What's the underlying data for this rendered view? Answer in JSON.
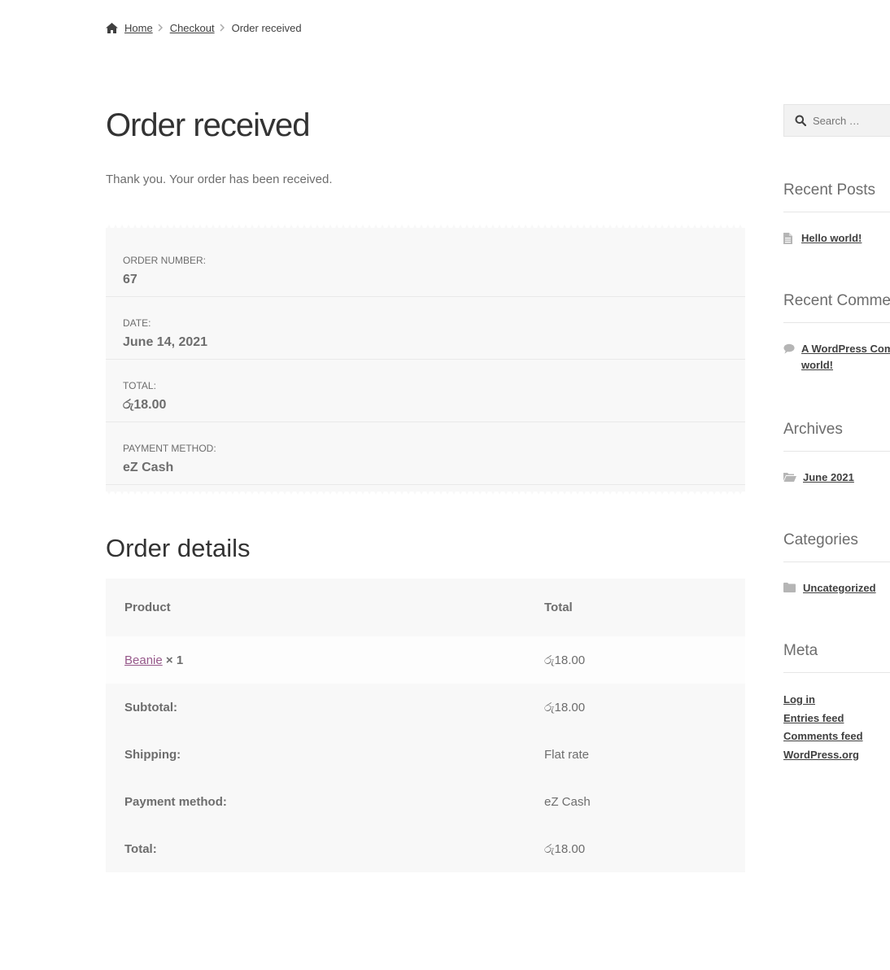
{
  "breadcrumb": {
    "home": "Home",
    "checkout": "Checkout",
    "current": "Order received"
  },
  "page": {
    "title": "Order received",
    "thanks": "Thank you. Your order has been received."
  },
  "overview": [
    {
      "label": "Order number:",
      "value": "67"
    },
    {
      "label": "Date:",
      "value": "June 14, 2021"
    },
    {
      "label": "Total:",
      "value": "රු18.00"
    },
    {
      "label": "Payment method:",
      "value": "eZ Cash"
    }
  ],
  "details": {
    "title": "Order details",
    "headers": {
      "product": "Product",
      "total": "Total"
    },
    "item": {
      "name": "Beanie",
      "qty": "× 1",
      "total": "රු18.00"
    },
    "rows": [
      {
        "label": "Subtotal:",
        "value": "රු18.00"
      },
      {
        "label": "Shipping:",
        "value": "Flat rate"
      },
      {
        "label": "Payment method:",
        "value": "eZ Cash"
      },
      {
        "label": "Total:",
        "value": "රු18.00"
      }
    ]
  },
  "sidebar": {
    "search_placeholder": "Search …",
    "recent_posts": {
      "title": "Recent Posts",
      "items": [
        "Hello world!"
      ]
    },
    "recent_comments": {
      "title": "Recent Comments",
      "line1": "A WordPress Commenter on Hello",
      "line2": "world!"
    },
    "archives": {
      "title": "Archives",
      "items": [
        "June 2021"
      ]
    },
    "categories": {
      "title": "Categories",
      "items": [
        "Uncategorized"
      ]
    },
    "meta": {
      "title": "Meta",
      "items": [
        "Log in",
        "Entries feed",
        "Comments feed",
        "WordPress.org"
      ]
    }
  },
  "colors": {
    "accent": "#96588a",
    "text": "#6d6d6d",
    "heading": "#333333",
    "panel": "#f8f8f8"
  },
  "icons": [
    "home-icon",
    "chevron-right-icon",
    "search-icon",
    "document-icon",
    "comment-icon",
    "folder-open-icon",
    "folder-icon"
  ]
}
